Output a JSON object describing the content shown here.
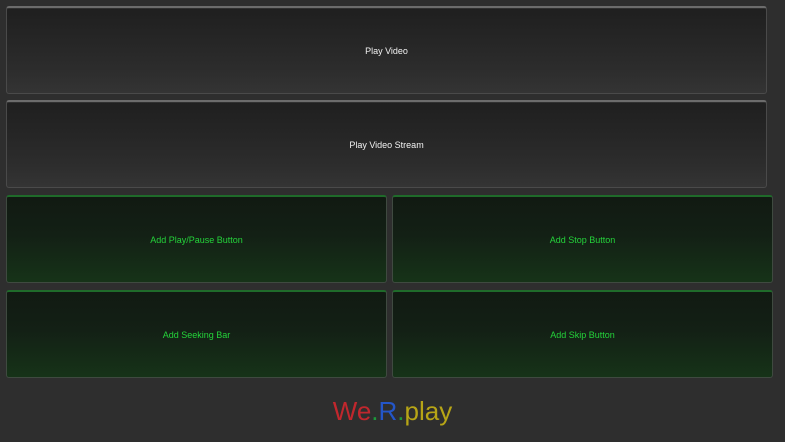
{
  "buttons": {
    "play_video": "Play Video",
    "play_video_stream": "Play Video Stream",
    "add_play_pause": "Add Play/Pause Button",
    "add_stop": "Add Stop Button",
    "add_seeking_bar": "Add Seeking Bar",
    "add_skip": "Add Skip Button"
  },
  "logo": {
    "part1": "We",
    "dot1": ".",
    "part2": "R",
    "dot2": ".",
    "part3": "play"
  },
  "colors": {
    "background": "#2e2e2e",
    "gray_button_text": "#f2f2f2",
    "green_button_text": "#24d33a",
    "logo_we": "#c1272d",
    "logo_r": "#2456c9",
    "logo_play": "#b7a516",
    "logo_dots": "#1c9a3a"
  }
}
